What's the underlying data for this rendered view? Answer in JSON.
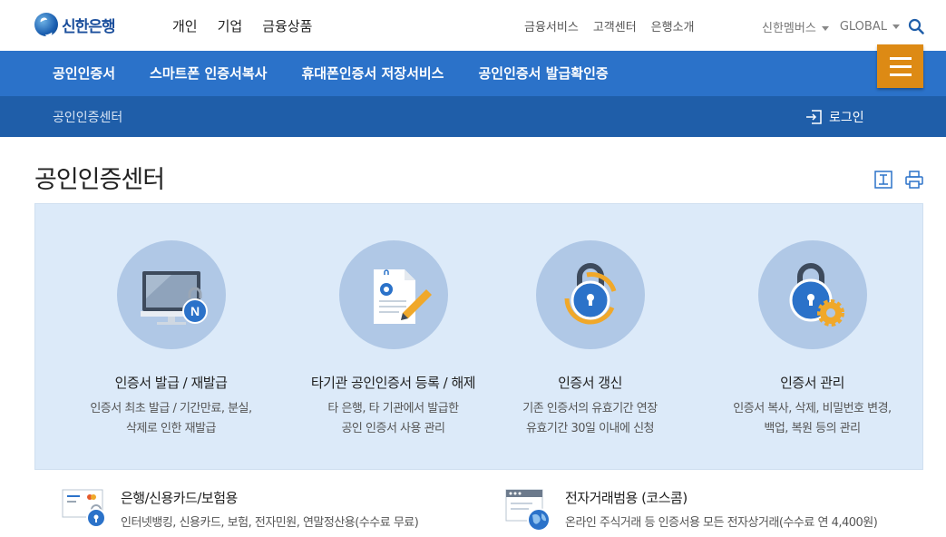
{
  "header": {
    "logo_text": "신한은행",
    "main_nav": [
      "개인",
      "기업",
      "금융상품"
    ],
    "util_nav": [
      "금융서비스",
      "고객센터",
      "은행소개"
    ],
    "member": "신한멤버스",
    "global": "GLOBAL"
  },
  "blue_nav": [
    "공인인증서",
    "스마트폰 인증서복사",
    "휴대폰인증서 저장서비스",
    "공인인증서 발급확인증"
  ],
  "subbar": {
    "title": "공인인증센터",
    "login": "로그인"
  },
  "page": {
    "title": "공인인증센터"
  },
  "cards": [
    {
      "title": "인증서 발급 / 재발급",
      "desc1": "인증서 최초 발급 / 기간만료, 분실,",
      "desc2": "삭제로 인한 재발급"
    },
    {
      "title": "타기관 공인인증서 등록 / 해제",
      "desc1": "타 은행, 타 기관에서 발급한",
      "desc2": "공인 인증서 사용 관리"
    },
    {
      "title": "인증서 갱신",
      "desc1": "기존 인증서의 유효기간 연장",
      "desc2": "유효기간 30일 이내에 신청"
    },
    {
      "title": "인증서 관리",
      "desc1": "인증서 복사, 삭제, 비밀번호 변경,",
      "desc2": "백업, 복원 등의 관리"
    }
  ],
  "bottom": [
    {
      "title": "은행/신용카드/보험용",
      "desc": "인터넷뱅킹, 신용카드, 보험, 전자민원, 연말정산용(수수료 무료)"
    },
    {
      "title": "전자거래범용 (코스콤)",
      "desc": "온라인 주식거래 등 인증서용 모든 전자상거래(수수료 연 4,400원)"
    }
  ],
  "colors": {
    "primary_blue": "#2b72c9",
    "dark_blue": "#1f5ea9",
    "menu_orange": "#dd8a14",
    "panel_bg": "#dceaf9"
  }
}
